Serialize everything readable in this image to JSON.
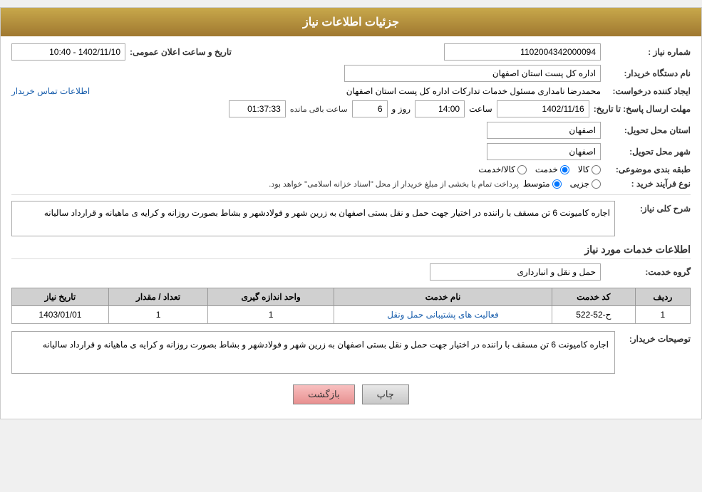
{
  "header": {
    "title": "جزئیات اطلاعات نیاز"
  },
  "fields": {
    "need_number_label": "شماره نیاز :",
    "need_number_value": "1102004342000094",
    "buyer_org_label": "نام دستگاه خریدار:",
    "buyer_org_value": "اداره کل پست استان اصفهان",
    "announce_date_label": "تاریخ و ساعت اعلان عمومی:",
    "announce_date_value": "1402/11/10 - 10:40",
    "requester_label": "ایجاد کننده درخواست:",
    "requester_value": "محمدرضا نامداری مسئول خدمات تداركات اداره كل پست استان اصفهان",
    "contact_link": "اطلاعات تماس خریدار",
    "response_deadline_label": "مهلت ارسال پاسخ: تا تاریخ:",
    "response_date": "1402/11/16",
    "response_time_label": "ساعت",
    "response_time": "14:00",
    "response_days_label": "روز و",
    "response_days": "6",
    "response_remaining_label": "ساعت باقی مانده",
    "response_remaining": "01:37:33",
    "province_label": "استان محل تحویل:",
    "province_value": "اصفهان",
    "city_label": "شهر محل تحویل:",
    "city_value": "اصفهان",
    "category_label": "طبقه بندی موضوعی:",
    "category_options": [
      {
        "label": "کالا",
        "value": "kala"
      },
      {
        "label": "خدمت",
        "value": "khedmat",
        "checked": true
      },
      {
        "label": "کالا/خدمت",
        "value": "kala_khedmat"
      }
    ],
    "purchase_type_label": "نوع فرآیند خرید :",
    "purchase_type_options": [
      {
        "label": "جزیی",
        "value": "jozi"
      },
      {
        "label": "متوسط",
        "value": "motavaset",
        "checked": true
      }
    ],
    "purchase_type_note": "پرداخت تمام یا بخشی از مبلغ خریدار از محل \"اسناد خزانه اسلامی\" خواهد بود.",
    "need_description_label": "شرح کلی نیاز:",
    "need_description_value": "اجاره کامیونت 6 تن  مسقف با راننده در اختیار جهت حمل و نقل بستی اصفهان به زرین شهر و فولادشهر و بشاط بصورت روزانه و کرایه ی ماهیانه و قرارداد سالیانه",
    "service_info_label": "اطلاعات خدمات مورد نیاز",
    "service_group_label": "گروه خدمت:",
    "service_group_value": "حمل و نقل و انبارداری"
  },
  "table": {
    "headers": [
      "ردیف",
      "کد خدمت",
      "نام خدمت",
      "واحد اندازه گیری",
      "تعداد / مقدار",
      "تاریخ نیاز"
    ],
    "rows": [
      {
        "row": "1",
        "code": "ح-52-522",
        "name": "فعالیت های پشتیبانی حمل ونقل",
        "unit": "1",
        "quantity": "1",
        "date": "1403/01/01"
      }
    ]
  },
  "buyer_desc_label": "توصیحات خریدار:",
  "buyer_desc_value": "اجاره کامیونت 6 تن  مسقف با راننده در اختیار جهت حمل و نقل بستی اصفهان به زرین شهر و فولادشهر و بشاط بصورت روزانه و کرایه ی ماهیانه و قرارداد سالیانه",
  "buttons": {
    "print_label": "چاپ",
    "back_label": "بازگشت"
  }
}
